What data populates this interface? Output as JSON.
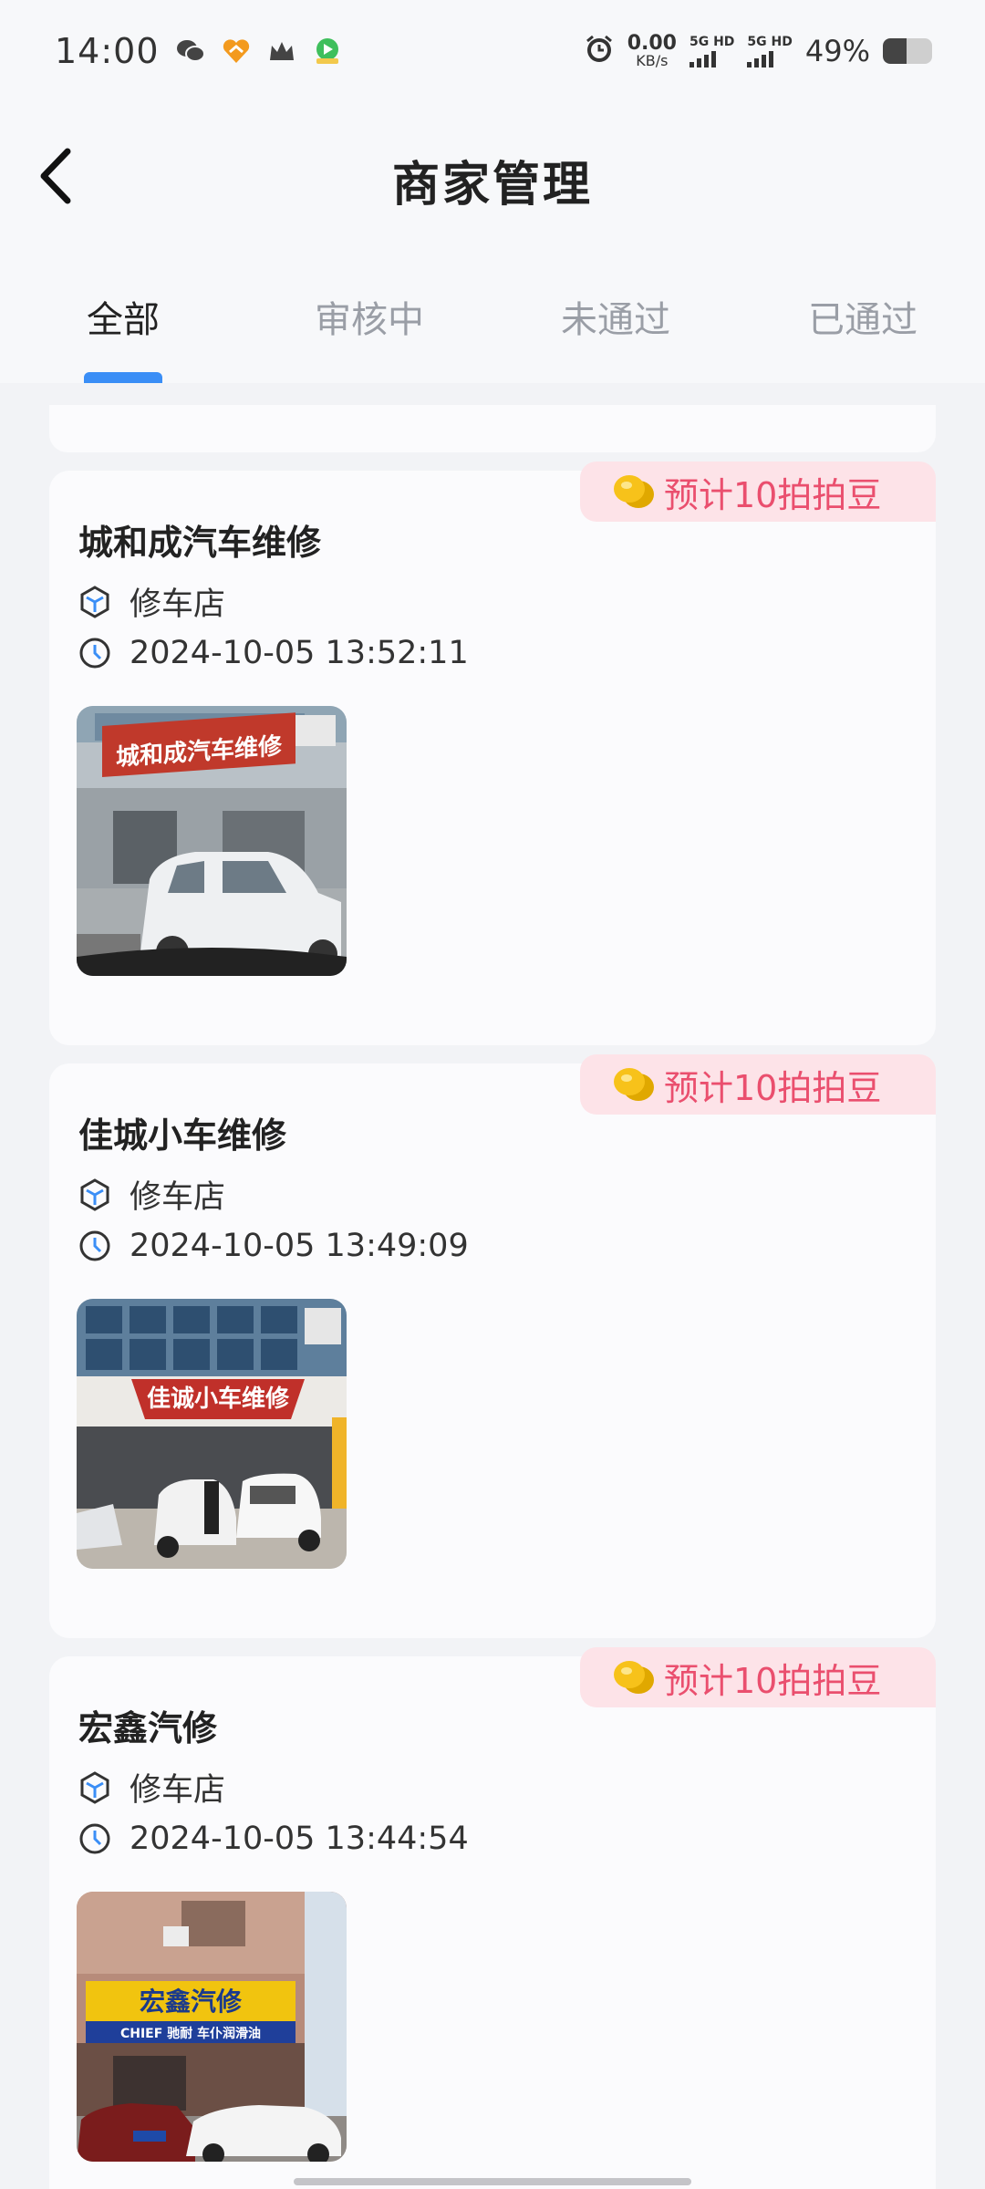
{
  "status_bar": {
    "time": "14:00",
    "net_speed_value": "0.00",
    "net_speed_unit": "KB/s",
    "sim1_label": "5G HD",
    "sim2_label": "5G HD",
    "battery_percent": "49%",
    "battery_level": 0.49,
    "app_icons": [
      "wechat-icon",
      "app-heart-icon",
      "crown-icon",
      "video-app-icon"
    ]
  },
  "header": {
    "title": "商家管理",
    "back_icon": "chevron-left-icon"
  },
  "tabs": [
    {
      "label": "全部",
      "active": true
    },
    {
      "label": "审核中",
      "active": false
    },
    {
      "label": "未通过",
      "active": false
    },
    {
      "label": "已通过",
      "active": false
    }
  ],
  "colors": {
    "accent": "#3a8ef6",
    "badge_bg": "#fde3e8",
    "badge_text": "#ea4f6e"
  },
  "merchants": [
    {
      "badge": "预计10拍拍豆",
      "name": "城和成汽车维修",
      "category": "修车店",
      "time": "2024-10-05 13:52:11",
      "photo_sign": "城和成汽车维修"
    },
    {
      "badge": "预计10拍拍豆",
      "name": "佳城小车维修",
      "category": "修车店",
      "time": "2024-10-05 13:49:09",
      "photo_sign": "佳诚小车维修"
    },
    {
      "badge": "预计10拍拍豆",
      "name": "宏鑫汽修",
      "category": "修车店",
      "time": "2024-10-05 13:44:54",
      "photo_sign": "宏鑫汽修",
      "photo_sign2": "CHIEF 驰耐 车仆润滑油"
    }
  ]
}
